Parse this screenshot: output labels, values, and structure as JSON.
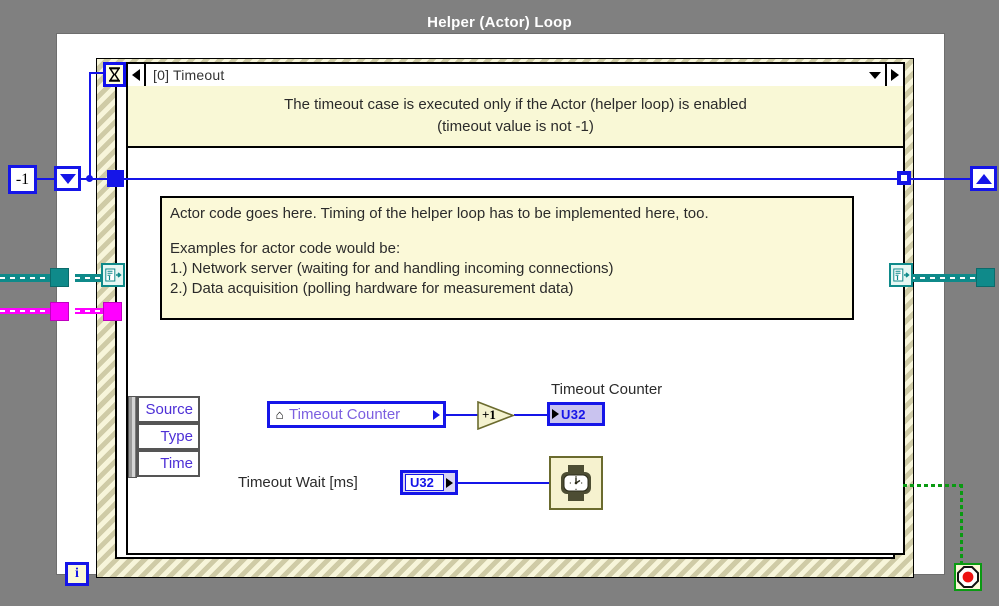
{
  "window": {
    "title": "Helper (Actor) Loop"
  },
  "case_structure": {
    "selector_label": "[0] Timeout",
    "left_arrow_icon": "left-arrow-icon",
    "right_arrow_icon": "right-arrow-icon",
    "dropdown_icon": "chevron-down-icon",
    "selector_terminal_icon": "hourglass-icon",
    "note_line1": "The timeout case is executed only if the Actor (helper loop) is enabled",
    "note_line2": "(timeout value is not -1)"
  },
  "comment_box": {
    "line1": "Actor code goes here. Timing of the helper loop has to be implemented here, too.",
    "line2": "",
    "line3": "Examples for actor code would be:",
    "line4": "1.) Network server (waiting for and handling incoming connections)",
    "line5": "2.) Data acquisition (polling hardware for measurement data)"
  },
  "cluster": {
    "items": [
      {
        "label": "Source"
      },
      {
        "label": "Type"
      },
      {
        "label": "Time"
      }
    ]
  },
  "nodes": {
    "local_variable": {
      "label": "Timeout Counter",
      "icon": "home-icon"
    },
    "increment": {
      "label": "+1",
      "icon": "increment-triangle-icon"
    },
    "timeout_counter_indicator": {
      "caption": "Timeout Counter",
      "datatype": "U32"
    },
    "timeout_wait_control": {
      "caption": "Timeout Wait [ms]",
      "datatype": "U32"
    },
    "wait_function": {
      "icon": "wristwatch-wait-icon"
    }
  },
  "terminals": {
    "timeout_constant": "-1",
    "iteration_terminal": "i",
    "stop_terminal_icon": "stop-sign-icon",
    "shift_register_left_icon": "shift-register-down-icon",
    "shift_register_right_icon": "shift-register-up-icon"
  },
  "colors": {
    "window_background": "#808080",
    "diagram_background": "#ffffff",
    "loop_border": "#f7f5da",
    "numeric_wire": "#1515e8",
    "refnum_wire": "#0f8a8a",
    "magenta_wire": "#ff00ff",
    "boolean_wire": "#0a9a12",
    "comment_background": "#fbf9d8",
    "note_background": "#f9f8d6",
    "local_variable_text": "#7c5fe0",
    "cluster_text": "#4d2fd6"
  }
}
